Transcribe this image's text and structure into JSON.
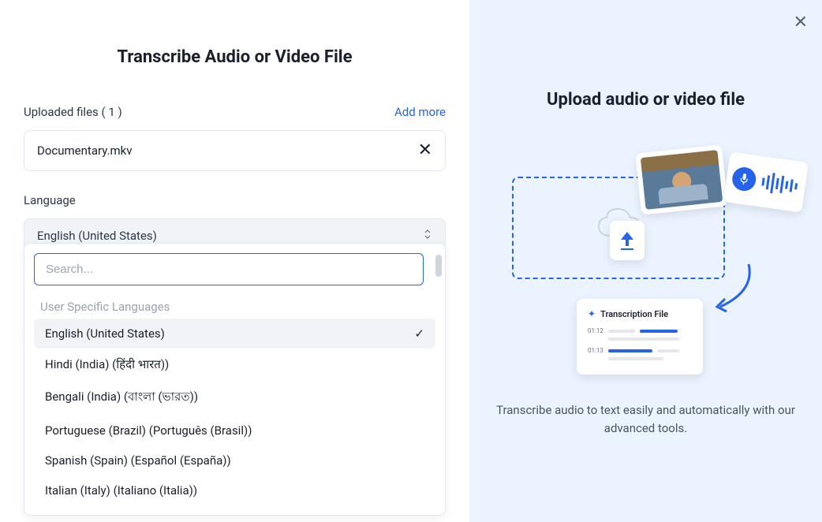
{
  "title": "Transcribe Audio or Video File",
  "uploaded": {
    "label": "Uploaded files ( 1 )",
    "add_more": "Add more",
    "file": "Documentary.mkv"
  },
  "language": {
    "label": "Language",
    "selected": "English (United States)",
    "search_placeholder": "Search...",
    "group_label": "User Specific Languages",
    "options": [
      "English (United States)",
      "Hindi (India) (हिंदी भारत))",
      "Bengali (India) (বাংলা (ভারত))",
      "Portuguese (Brazil) (Português (Brasil))",
      "Spanish (Spain) (Español (España))",
      "Italian (Italy) (Italiano (Italia))"
    ]
  },
  "right": {
    "title": "Upload audio or video file",
    "description": "Transcribe audio to text easily and automatically with our advanced tools.",
    "card_label": "Transcription File",
    "time1": "01:12",
    "time2": "01:13"
  }
}
